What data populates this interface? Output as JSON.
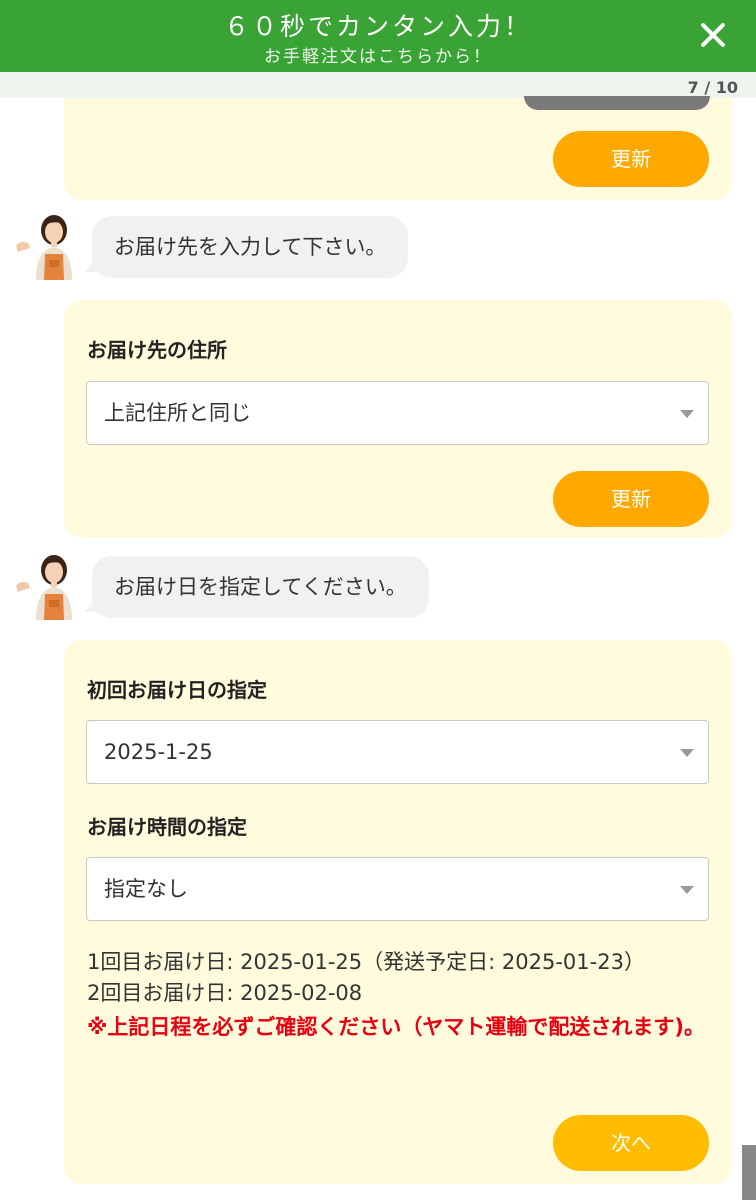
{
  "header": {
    "title": "６０秒でカンタン入力！",
    "subtitle": "お手軽注文はこちらから！"
  },
  "progress": {
    "text": "7 / 10"
  },
  "buttons": {
    "update": "更新",
    "next": "次へ"
  },
  "messages": [
    {
      "text": "お届け先を入力して下さい。"
    },
    {
      "text": "お届け日を指定してください。"
    }
  ],
  "address_section": {
    "label": "お届け先の住所",
    "selected": "上記住所と同じ"
  },
  "date_section": {
    "first_delivery_label": "初回お届け日の指定",
    "first_delivery_selected": "2025-1-25",
    "time_label": "お届け時間の指定",
    "time_selected": "指定なし",
    "line1": "1回目お届け日: 2025-01-25（発送予定日: 2025-01-23）",
    "line2": "2回目お届け日: 2025-02-08",
    "warning": "※上記日程を必ずご確認ください（ヤマト運輸で配送されます)。"
  },
  "colors": {
    "header_green": "#3aa335",
    "card_yellow": "#fffbdc",
    "button_orange": "#ffa800",
    "warning_red": "#e60012"
  },
  "icons": {
    "close": "close-icon",
    "avatar": "staff-avatar",
    "caret": "chevron-down-icon"
  }
}
